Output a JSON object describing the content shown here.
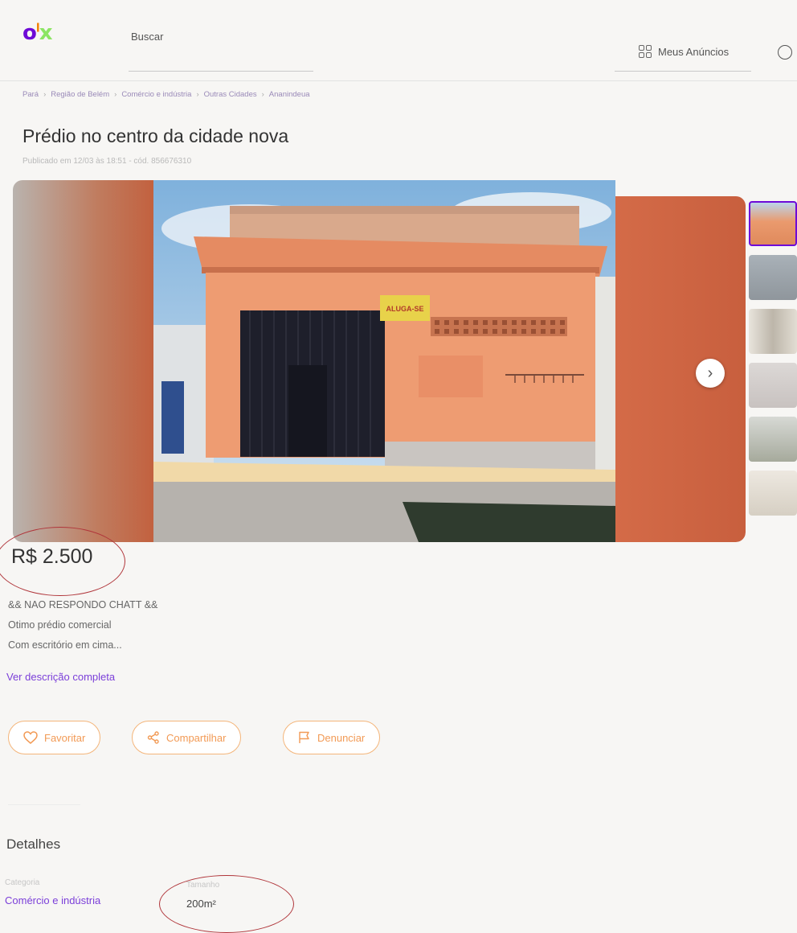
{
  "header": {
    "logo": {
      "o": "o",
      "l": "l",
      "x": "x"
    },
    "search_label": "Buscar",
    "my_ads_label": "Meus Anúncios"
  },
  "breadcrumb": [
    "Pará",
    "Região de Belém",
    "Comércio e indústria",
    "Outras Cidades",
    "Ananindeua"
  ],
  "listing": {
    "title": "Prédio no centro da cidade nova",
    "published": "Publicado em 12/03 às 18:51 - cód. 856676310",
    "price": "R$ 2.500",
    "description_lines": [
      "&& NAO RESPONDO CHATT &&",
      "Otimo prédio comercial",
      "Com escritório em cima..."
    ],
    "see_more": "Ver descrição completa",
    "photo_sign": "ALUGA-SE"
  },
  "actions": {
    "favorite": "Favoritar",
    "share": "Compartilhar",
    "report": "Denunciar"
  },
  "details": {
    "title": "Detalhes",
    "category_label": "Categoria",
    "category_value": "Comércio e indústria",
    "size_label": "Tamanho",
    "size_value": "200m²"
  },
  "colors": {
    "brand_purple": "#6e0ad6",
    "brand_orange": "#f28000",
    "brand_green": "#8ce563",
    "annotation_red": "#b0353a"
  }
}
